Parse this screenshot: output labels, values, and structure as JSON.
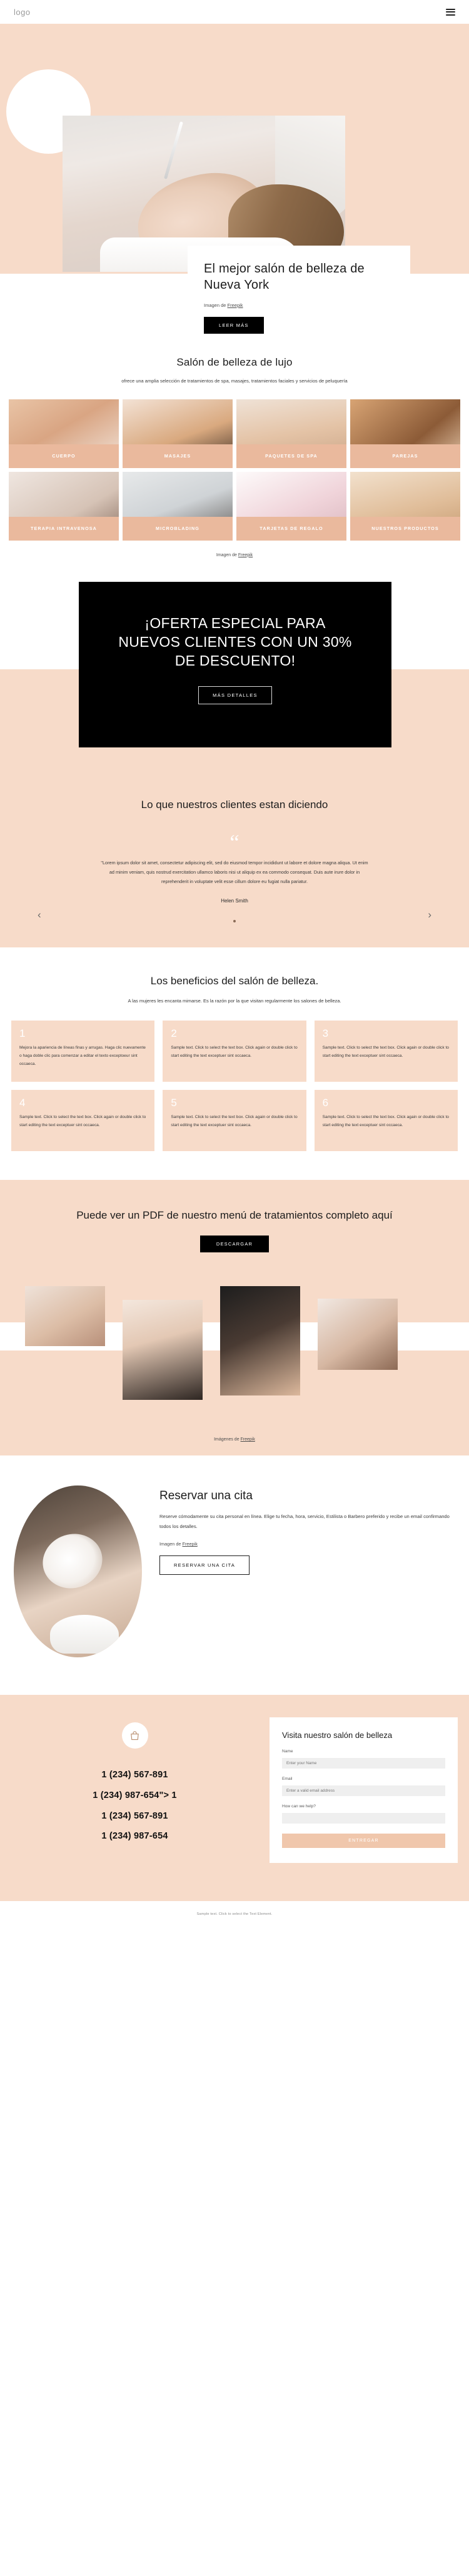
{
  "header": {
    "logo": "logo",
    "menu_label": "menu"
  },
  "hero": {
    "title": "El mejor salón de belleza de Nueva York",
    "credit_prefix": "Imagen de ",
    "credit_link": "Freepik",
    "cta": "LEER MÁS"
  },
  "services": {
    "title": "Salón de belleza de lujo",
    "subtitle": "ofrece una amplia selección de tratamientos de spa, masajes, tratamientos faciales y servicios de peluquería",
    "cards": [
      {
        "label": "CUERPO",
        "img": "ph-a"
      },
      {
        "label": "MASAJES",
        "img": "ph-b"
      },
      {
        "label": "PAQUETES DE SPA",
        "img": "ph-c"
      },
      {
        "label": "PAREJAS",
        "img": "ph-d"
      },
      {
        "label": "TERAPIA INTRAVENOSA",
        "img": "ph-e"
      },
      {
        "label": "MICROBLADING",
        "img": "ph-f"
      },
      {
        "label": "TARJETAS DE REGALO",
        "img": "ph-g"
      },
      {
        "label": "NUESTROS PRODUCTOS",
        "img": "ph-h"
      }
    ],
    "credit_prefix": "Imagen de ",
    "credit_link": "Freepik"
  },
  "offer": {
    "title": "¡OFERTA ESPECIAL PARA NUEVOS CLIENTES CON UN 30% DE DESCUENTO!",
    "cta": "MÁS DETALLES"
  },
  "testimonials": {
    "title": "Lo que nuestros clientes estan diciendo",
    "quote_mark": "“",
    "body": "\"Lorem ipsum dolor sit amet, consectetur adipiscing elit, sed do eiusmod tempor incididunt ut labore et dolore magna aliqua. Ut enim ad minim veniam, quis nostrud exercitation ullamco laboris nisi ut aliquip ex ea commodo consequat. Duis aute irure dolor in reprehenderit in voluptate velit esse cillum dolore eu fugiat nulla pariatur.",
    "author": "Helen Smith",
    "prev": "‹",
    "next": "›"
  },
  "benefits": {
    "title": "Los beneficios del salón de belleza.",
    "subtitle": "A las mujeres les encanta mimarse. Es la razón por la que visitan regularmente los salones de belleza.",
    "items": [
      {
        "num": "1",
        "text": "Mejora la apariencia de líneas finas y arrugas. Haga clic nuevamente o haga doble clic para comenzar a editar el texto exceptoeur sint occaeca."
      },
      {
        "num": "2",
        "text": "Sample text. Click to select the text box. Click again or double click to start editing the text exceptuer sint occaeca."
      },
      {
        "num": "3",
        "text": "Sample text. Click to select the text box. Click again or double click to start editing the text exceptuer sint occaeca."
      },
      {
        "num": "4",
        "text": "Sample text. Click to select the text box. Click again or double click to start editing the text exceptuer sint occaeca."
      },
      {
        "num": "5",
        "text": "Sample text. Click to select the text box. Click again or double click to start editing the text exceptuer sint occaeca."
      },
      {
        "num": "6",
        "text": "Sample text. Click to select the text box. Click again or double click to start editing the text exceptuer sint occaeca."
      }
    ]
  },
  "pdf": {
    "title": "Puede ver un PDF de nuestro menú de tratamientos completo aquí",
    "cta": "DESCARGAR",
    "credit_prefix": "Imágenes de ",
    "credit_link": "Freepik"
  },
  "appointment": {
    "title": "Reservar una cita",
    "text": "Reserve cómodamente su cita personal en línea. Elige tu fecha, hora, servicio, Estilista o Barbero preferido y recibe un email confirmando todos los detalles.",
    "credit_prefix": "Imagen de ",
    "credit_link": "Freepik",
    "cta": "RESERVAR UNA CITA"
  },
  "contact": {
    "icon": "shopping-bag-icon",
    "phones": [
      "1 (234) 567-891",
      "1 (234) 987-654\"> 1",
      "1 (234) 567-891",
      "1 (234) 987-654"
    ],
    "form": {
      "title": "Visita nuestro salón de belleza",
      "fields": [
        {
          "label": "Name",
          "placeholder": "Enter your Name",
          "value": ""
        },
        {
          "label": "Email",
          "placeholder": "Enter a valid email address",
          "value": ""
        },
        {
          "label": "How can we help?",
          "placeholder": "",
          "value": ""
        }
      ],
      "submit": "ENTREGAR"
    }
  },
  "footer": {
    "text": "Sample text. Click to select the Text Element."
  }
}
